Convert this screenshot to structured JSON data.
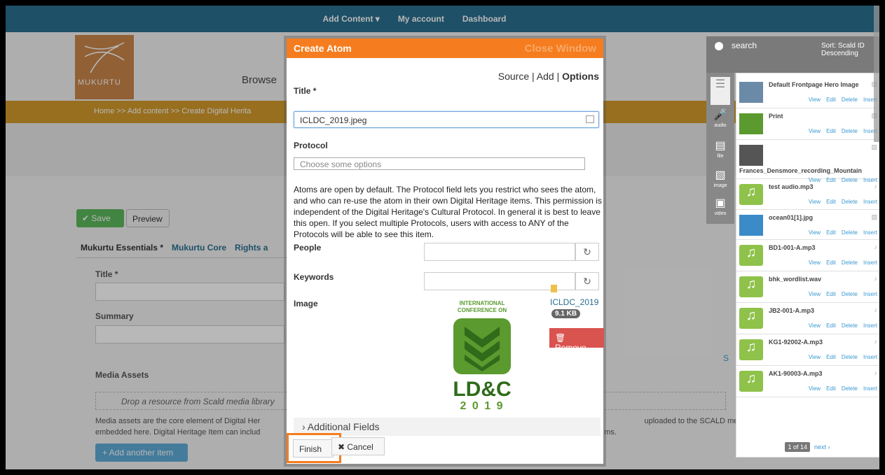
{
  "topnav": {
    "items": [
      "Add Content ▾",
      "My account",
      "Dashboard"
    ]
  },
  "site": {
    "logo_text": "MUKURTU",
    "browse_label": "Browse"
  },
  "breadcrumb": {
    "text": "Home >> Add content >> Create Digital Herita"
  },
  "form": {
    "save_label": "✔ Save",
    "preview_label": "Preview",
    "tabs": [
      "Mukurtu Essentials *",
      "Mukurtu Core",
      "Rights a"
    ],
    "title_label": "Title *",
    "summary_label": "Summary",
    "media_assets_label": "Media Assets",
    "drop_text": "Drop a resource from Scald media library",
    "media_desc_left": "Media assets are the core element of Digital Her",
    "media_desc_left2": "embedded here. Digital Heritage Item can includ",
    "media_desc_right": "uploaded to the SCALD media li",
    "media_desc_right2": "ms.",
    "add_another": "+ Add another item",
    "side_letter": "S"
  },
  "modal": {
    "header_title": "Create Atom",
    "close_label": "Close Window",
    "source_nav": {
      "source": "Source",
      "sep1": " | ",
      "add": "Add",
      "sep2": " | ",
      "options": "Options"
    },
    "title_label": "Title *",
    "title_value": "ICLDC_2019.jpeg",
    "protocol_label": "Protocol",
    "protocol_placeholder": "Choose some options",
    "protocol_desc": "Atoms are open by default. The Protocol field lets you restrict who sees the atom, and who can re-use the atom in their own Digital Heritage items. This permission is independent of the Digital Heritage's Cultural Protocol. In general it is best to leave this open. If you select multiple Protocols, users with access to ANY of the Protocols will be able to see this item.",
    "people_label": "People",
    "keywords_label": "Keywords",
    "image_label": "Image",
    "image_caption_top": "INTERNATIONAL CONFERENCE ON",
    "image_caption_big": "LD&C",
    "image_caption_year": "2 0 1 9",
    "file_name": "ICLDC_2019",
    "file_size": "9.1 KB",
    "remove_label": "🗑 Remove",
    "additional_fields": "› Additional Fields",
    "finish_label": "Finish",
    "cancel_label": "✖ Cancel"
  },
  "library": {
    "search_label": "search",
    "sort_label": "Sort: Scald ID Descending",
    "types": [
      "",
      "audio",
      "file",
      "image",
      "video"
    ],
    "actions": [
      "View",
      "Edit",
      "Delete",
      "Insert"
    ],
    "items": [
      {
        "name": "Default Frontpage Hero Image",
        "kind": "image"
      },
      {
        "name": "Print",
        "kind": "image"
      },
      {
        "name": "Frances_Densmore_recording_Mountain",
        "kind": "image"
      },
      {
        "name": "test audio.mp3",
        "kind": "audio"
      },
      {
        "name": "ocean01[1].jpg",
        "kind": "image"
      },
      {
        "name": "BD1-001-A.mp3",
        "kind": "audio"
      },
      {
        "name": "bhk_wordlist.wav",
        "kind": "audio"
      },
      {
        "name": "JB2-001-A.mp3",
        "kind": "audio"
      },
      {
        "name": "KG1-92002-A.mp3",
        "kind": "audio"
      },
      {
        "name": "AK1-90003-A.mp3",
        "kind": "audio"
      }
    ],
    "pager_current": "1 of 14",
    "pager_next": "next ›"
  },
  "colors": {
    "topnav": "#2a6f8f",
    "modal_header": "#f57d1f",
    "breadcrumb": "#d29a2c",
    "remove": "#d9534f",
    "link": "#3b9ad1"
  }
}
